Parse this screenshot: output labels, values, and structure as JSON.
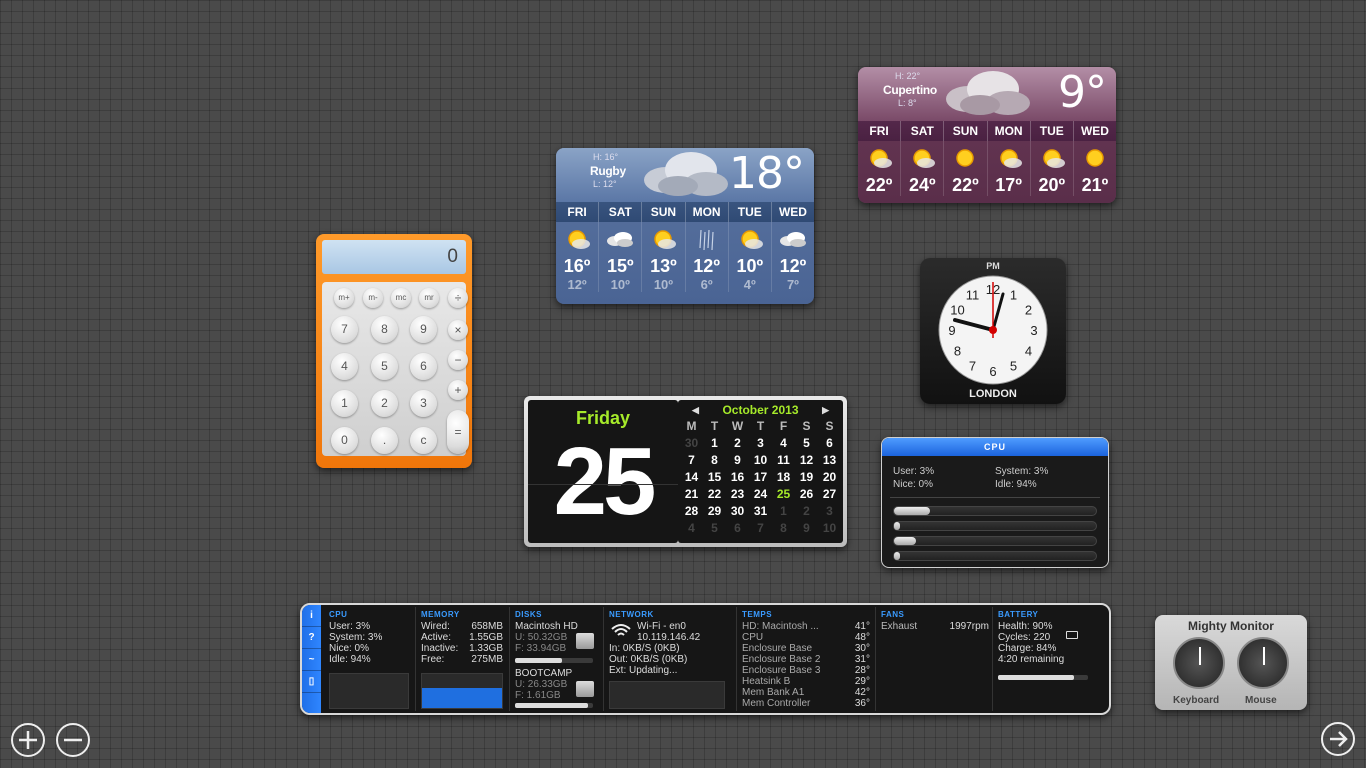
{
  "weather_rugby": {
    "hi": "H: 16°",
    "lo": "L: 12°",
    "city": "Rugby",
    "temp": "18°",
    "days": [
      "FRI",
      "SAT",
      "SUN",
      "MON",
      "TUE",
      "WED"
    ],
    "highs": [
      "16º",
      "15º",
      "13º",
      "12º",
      "10º",
      "12º"
    ],
    "lows": [
      "12º",
      "10º",
      "10º",
      "6º",
      "4º",
      "7º"
    ],
    "icons": [
      "sun-cloud-icon",
      "cloud-icon",
      "sun-cloud-icon",
      "rain-icon",
      "sun-cloud-icon",
      "cloud-icon"
    ]
  },
  "weather_cupertino": {
    "hi": "H: 22°",
    "lo": "L: 8°",
    "city": "Cupertino",
    "temp": "9°",
    "days": [
      "FRI",
      "SAT",
      "SUN",
      "MON",
      "TUE",
      "WED"
    ],
    "highs": [
      "22º",
      "24º",
      "22º",
      "17º",
      "20º",
      "21º"
    ],
    "icons": [
      "sun-cloud-icon",
      "sun-cloud-icon",
      "sun-icon",
      "sun-cloud-icon",
      "sun-cloud-icon",
      "sun-icon"
    ]
  },
  "calculator": {
    "display": "0",
    "memory_keys": [
      "m+",
      "m-",
      "mc",
      "mr"
    ],
    "divide": "÷",
    "multiply": "×",
    "minus": "−",
    "plus": "+",
    "equals": "=",
    "digits": [
      "7",
      "8",
      "9",
      "4",
      "5",
      "6",
      "1",
      "2",
      "3",
      "0",
      ".",
      "c"
    ]
  },
  "clock": {
    "period": "PM",
    "city": "LONDON",
    "numbers": [
      "12",
      "1",
      "2",
      "3",
      "4",
      "5",
      "6",
      "7",
      "8",
      "9",
      "10",
      "11"
    ]
  },
  "calendar": {
    "day_name": "Friday",
    "day_number": "25",
    "month": "October 2013",
    "weekday_headers": [
      "M",
      "T",
      "W",
      "T",
      "F",
      "S",
      "S"
    ],
    "cells": [
      {
        "d": "30",
        "dim": true
      },
      {
        "d": "1"
      },
      {
        "d": "2"
      },
      {
        "d": "3"
      },
      {
        "d": "4"
      },
      {
        "d": "5"
      },
      {
        "d": "6"
      },
      {
        "d": "7"
      },
      {
        "d": "8"
      },
      {
        "d": "9"
      },
      {
        "d": "10"
      },
      {
        "d": "11"
      },
      {
        "d": "12"
      },
      {
        "d": "13"
      },
      {
        "d": "14"
      },
      {
        "d": "15"
      },
      {
        "d": "16"
      },
      {
        "d": "17"
      },
      {
        "d": "18"
      },
      {
        "d": "19"
      },
      {
        "d": "20"
      },
      {
        "d": "21"
      },
      {
        "d": "22"
      },
      {
        "d": "23"
      },
      {
        "d": "24"
      },
      {
        "d": "25",
        "today": true
      },
      {
        "d": "26"
      },
      {
        "d": "27"
      },
      {
        "d": "28"
      },
      {
        "d": "29"
      },
      {
        "d": "30"
      },
      {
        "d": "31"
      },
      {
        "d": "1",
        "dim": true
      },
      {
        "d": "2",
        "dim": true
      },
      {
        "d": "3",
        "dim": true
      },
      {
        "d": "4",
        "dim": true
      },
      {
        "d": "5",
        "dim": true
      },
      {
        "d": "6",
        "dim": true
      },
      {
        "d": "7",
        "dim": true
      },
      {
        "d": "8",
        "dim": true
      },
      {
        "d": "9",
        "dim": true
      },
      {
        "d": "10",
        "dim": true
      }
    ]
  },
  "cpu_widget": {
    "title": "CPU",
    "user": "User: 3%",
    "system": "System: 3%",
    "nice": "Nice: 0%",
    "idle": "Idle: 94%",
    "core_loads": [
      0.18,
      0.02,
      0.11,
      0.01
    ]
  },
  "monitor": {
    "side_icons": [
      "info-icon",
      "help-icon",
      "pulse-icon",
      "battery-icon"
    ],
    "side_labels": [
      "i",
      "?",
      "~",
      "▯"
    ],
    "cpu": {
      "title": "CPU",
      "lines": [
        "User: 3%",
        "System: 3%",
        "Nice: 0%",
        "Idle: 94%"
      ]
    },
    "memory": {
      "title": "MEMORY",
      "rows": [
        [
          "Wired:",
          "658MB"
        ],
        [
          "Active:",
          "1.55GB"
        ],
        [
          "Inactive:",
          "1.33GB"
        ],
        [
          "Free:",
          "275MB"
        ]
      ]
    },
    "disks": {
      "title": "DISKS",
      "d1_name": "Macintosh HD",
      "d1_used": "U: 50.32GB",
      "d1_free": "F: 33.94GB",
      "d1_used_fraction": 0.6,
      "d2_name": "BOOTCAMP",
      "d2_used": "U: 26.33GB",
      "d2_free": "F: 1.61GB",
      "d2_used_fraction": 0.94
    },
    "network": {
      "title": "NETWORK",
      "iface": "Wi-Fi - en0",
      "ip": "10.119.146.42",
      "in": "In: 0KB/S (0KB)",
      "out": "Out: 0KB/S (0KB)",
      "ext": "Ext: Updating..."
    },
    "temps": {
      "title": "TEMPS",
      "rows": [
        [
          "HD: Macintosh ...",
          "41°"
        ],
        [
          "CPU",
          "48°"
        ],
        [
          "Enclosure Base",
          "30°"
        ],
        [
          "Enclosure Base 2",
          "31°"
        ],
        [
          "Enclosure Base 3",
          "28°"
        ],
        [
          "Heatsink B",
          "29°"
        ],
        [
          "Mem Bank A1",
          "42°"
        ],
        [
          "Mem Controller",
          "36°"
        ]
      ]
    },
    "fans": {
      "title": "FANS",
      "name": "Exhaust",
      "rpm": "1997rpm"
    },
    "battery": {
      "title": "BATTERY",
      "health": "Health: 90%",
      "cycles": "Cycles: 220",
      "charge": "Charge: 84%",
      "remaining": "4:20 remaining",
      "charge_fraction": 0.84
    }
  },
  "mighty_monitor": {
    "title": "Mighty Monitor",
    "keyboard": "Keyboard",
    "mouse": "Mouse"
  },
  "controls": {
    "add": "+",
    "remove": "−",
    "next": "→"
  }
}
